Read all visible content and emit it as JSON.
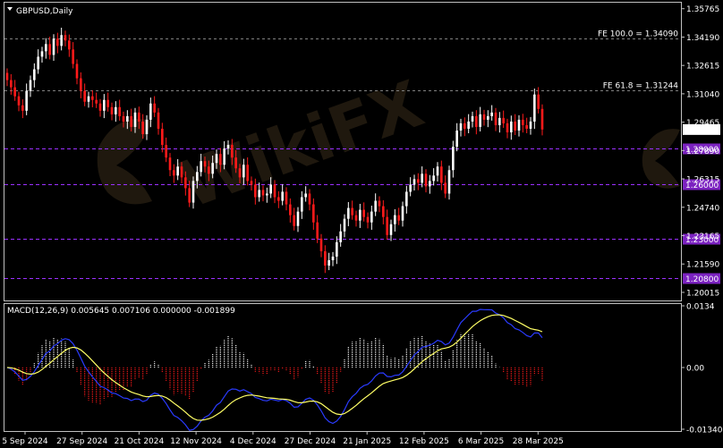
{
  "chart_data": [
    {
      "type": "candlestick",
      "title": "GBPUSD,Daily",
      "symbol": "GBPUSD",
      "timeframe": "Daily",
      "ylim": [
        1.19615,
        1.36
      ],
      "y_ticks": [
        "1.35765",
        "1.34190",
        "1.32615",
        "1.31040",
        "1.29465",
        "1.27890",
        "1.26315",
        "1.24740",
        "1.23165",
        "1.21590",
        "1.20015"
      ],
      "current_price": "1.29056",
      "x_ticks": [
        "5 Sep 2024",
        "27 Sep 2024",
        "21 Oct 2024",
        "12 Nov 2024",
        "4 Dec 2024",
        "27 Dec 2024",
        "21 Jan 2025",
        "12 Feb 2025",
        "6 Mar 2025",
        "28 Mar 2025"
      ],
      "fib_levels": [
        {
          "label": "FE 100.0 = 1.34090",
          "value": 1.3409
        },
        {
          "label": "FE 61.8 = 1.31244",
          "value": 1.31244
        }
      ],
      "support_levels": [
        {
          "label": "1.28000",
          "value": 1.28
        },
        {
          "label": "1.26000",
          "value": 1.26
        },
        {
          "label": "1.23000",
          "value": 1.23
        },
        {
          "label": "1.20800",
          "value": 1.208
        }
      ],
      "colors": {
        "bull": "#ffffff",
        "bear": "#ff1a1a",
        "level": "#9b30ff",
        "level_box": "#7b22c0",
        "fib": "#808080",
        "background": "#000000",
        "axis": "#c0c0c0"
      },
      "closes": [
        1.318,
        1.314,
        1.309,
        1.304,
        1.301,
        1.312,
        1.318,
        1.324,
        1.331,
        1.334,
        1.338,
        1.332,
        1.341,
        1.337,
        1.343,
        1.34,
        1.335,
        1.327,
        1.319,
        1.312,
        1.306,
        1.309,
        1.307,
        1.305,
        1.301,
        1.307,
        1.303,
        1.299,
        1.303,
        1.298,
        1.295,
        1.298,
        1.292,
        1.3,
        1.295,
        1.288,
        1.296,
        1.305,
        1.3,
        1.291,
        1.282,
        1.275,
        1.268,
        1.265,
        1.27,
        1.264,
        1.258,
        1.25,
        1.262,
        1.267,
        1.273,
        1.27,
        1.266,
        1.272,
        1.277,
        1.271,
        1.28,
        1.282,
        1.275,
        1.269,
        1.264,
        1.271,
        1.262,
        1.26,
        1.253,
        1.257,
        1.254,
        1.255,
        1.26,
        1.253,
        1.251,
        1.256,
        1.249,
        1.243,
        1.237,
        1.245,
        1.253,
        1.255,
        1.249,
        1.239,
        1.23,
        1.223,
        1.215,
        1.218,
        1.22,
        1.228,
        1.234,
        1.241,
        1.247,
        1.243,
        1.24,
        1.246,
        1.242,
        1.239,
        1.245,
        1.251,
        1.248,
        1.242,
        1.232,
        1.238,
        1.243,
        1.24,
        1.248,
        1.256,
        1.26,
        1.263,
        1.261,
        1.266,
        1.259,
        1.262,
        1.265,
        1.27,
        1.261,
        1.255,
        1.268,
        1.281,
        1.29,
        1.294,
        1.291,
        1.295,
        1.298,
        1.292,
        1.299,
        1.296,
        1.298,
        1.3,
        1.293,
        1.297,
        1.294,
        1.289,
        1.295,
        1.29,
        1.296,
        1.293,
        1.291,
        1.295,
        1.31,
        1.302,
        1.2906
      ],
      "macd": {
        "label": "MACD(12,26,9) 0.005645 0.007106 0.000000 -0.001899",
        "ylim": [
          -0.0134,
          0.0134
        ],
        "y_ticks": [
          "0.0134",
          "0.00",
          "-0.013402"
        ],
        "colors": {
          "macd": "#2a3bff",
          "signal": "#ffff66",
          "hist_pos": "#ffffff",
          "hist_neg": "#ff1a1a"
        }
      }
    }
  ]
}
